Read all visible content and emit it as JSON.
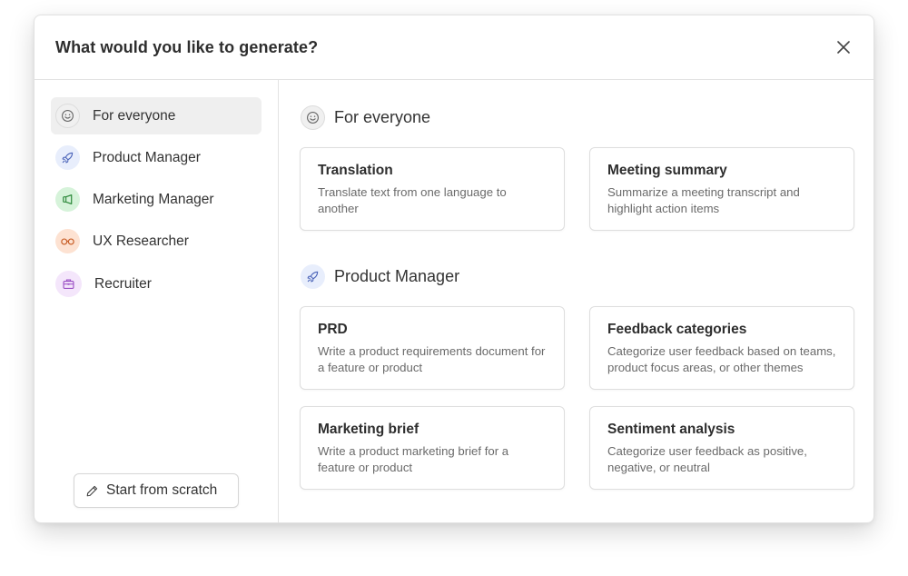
{
  "dialog": {
    "title": "What would you like to generate?",
    "close_icon": "close-icon"
  },
  "sidebar": {
    "items": [
      {
        "label": "For everyone",
        "icon": "smile-icon",
        "color": "#f0f0f0",
        "active": true
      },
      {
        "label": "Product Manager",
        "icon": "rocket-icon",
        "color": "#e8eefc",
        "active": false
      },
      {
        "label": "Marketing Manager",
        "icon": "megaphone-icon",
        "color": "#d6f3da",
        "active": false
      },
      {
        "label": "UX Researcher",
        "icon": "glasses-icon",
        "color": "#fde2d2",
        "active": false
      },
      {
        "label": "Recruiter",
        "icon": "briefcase-icon",
        "color": "#f4e6fb",
        "active": false
      }
    ],
    "scratch_button": {
      "label": "Start from scratch",
      "icon": "pencil-icon"
    }
  },
  "sections": [
    {
      "title": "For everyone",
      "icon": "smile-icon",
      "cards": [
        {
          "title": "Translation",
          "description": "Translate text from one language to another"
        },
        {
          "title": "Meeting summary",
          "description": "Summarize a meeting transcript and highlight action items"
        }
      ]
    },
    {
      "title": "Product Manager",
      "icon": "rocket-icon",
      "cards": [
        {
          "title": "PRD",
          "description": "Write a product requirements document for a feature or product"
        },
        {
          "title": "Feedback categories",
          "description": "Categorize user feedback based on teams, product focus areas, or other themes"
        },
        {
          "title": "Marketing brief",
          "description": "Write a product marketing brief for a feature or product"
        },
        {
          "title": "Sentiment analysis",
          "description": "Categorize user feedback as positive, negative, or neutral"
        }
      ]
    }
  ]
}
